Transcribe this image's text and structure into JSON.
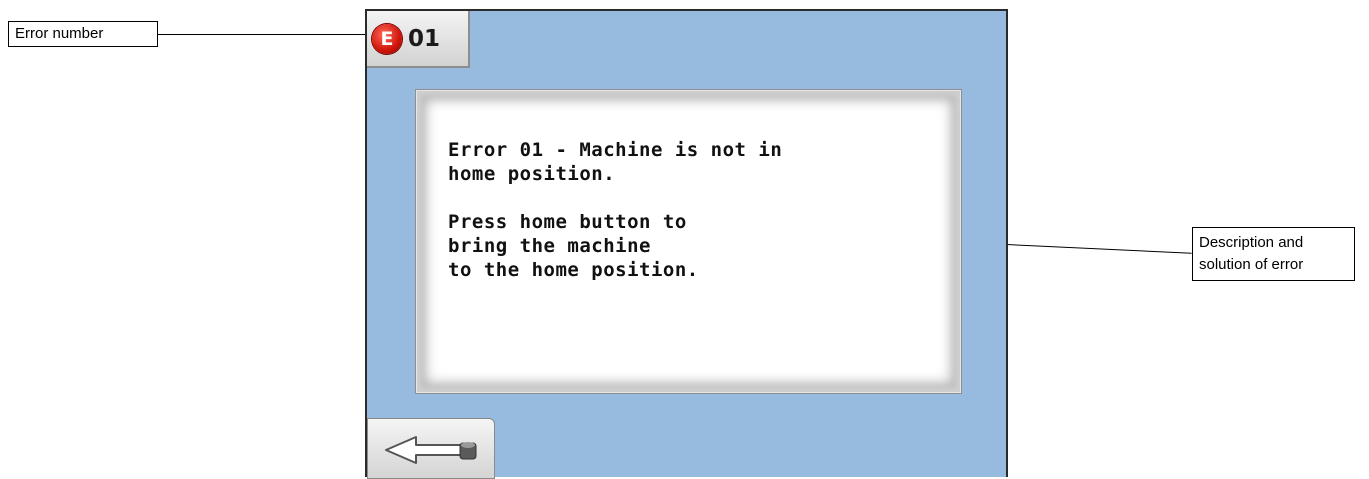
{
  "callouts": {
    "error_number": "Error number",
    "description_line1": "Description and",
    "description_line2": "solution of error"
  },
  "screen": {
    "badge_letter": "E",
    "error_code": "01",
    "message": {
      "line1": "Error 01 - Machine is not in",
      "line2": "home position.",
      "line3": "Press home button to",
      "line4": "bring the machine",
      "line5": "to the home position."
    },
    "back_button_icon": "back-arrow-icon"
  },
  "colors": {
    "screen_background": "#97bbdf",
    "badge_red": "#d0150a"
  }
}
